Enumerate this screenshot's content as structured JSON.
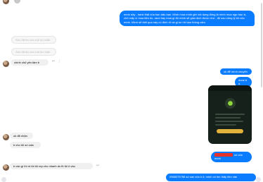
{
  "messages": {
    "out_intro": "mình dây , bank thật của bạn dấu bạn. Mình mua mình giờ xót dụng đông là mình mua ngư bạn à, chủ mấy ví mua tiền do, rand hay mua gì đó mình sẽ giao dịch được như , đủ sau công lý lời của mình. Mình sẽ biết qua này có đình rõ và gì ko rời bạn thông cảm",
    "in_faded_1": "Sơn đã thu hồi một tin nhắn",
    "in_faded_2": "Sơn đã thu hồi một tin nhắn",
    "in_chinh_chu": "chính chủ yên tâm b",
    "out_ok_chuyen": "ok để mình chuyển",
    "out_done": "done b ả",
    "in_ok_nhan": "ok đã nhận",
    "in_cho_so_zalo": "b cho tôi số zalo",
    "out_redacted_suffix": "số của mình",
    "in_can_gi": "b cần gì thì nt tôi tôi rep cho nhanh do fb tôi ít vào",
    "out_cut": "0968375?58 số san của b ỏ, mình có tìm thấy tiền cản"
  },
  "colors": {
    "outgoing": "#0a7cff",
    "incoming": "#f0f0f0",
    "faded_text": "#b9b9b9"
  },
  "icons": {
    "reply": "reply-icon",
    "more": "more-icon",
    "avatar": "avatar-icon"
  }
}
